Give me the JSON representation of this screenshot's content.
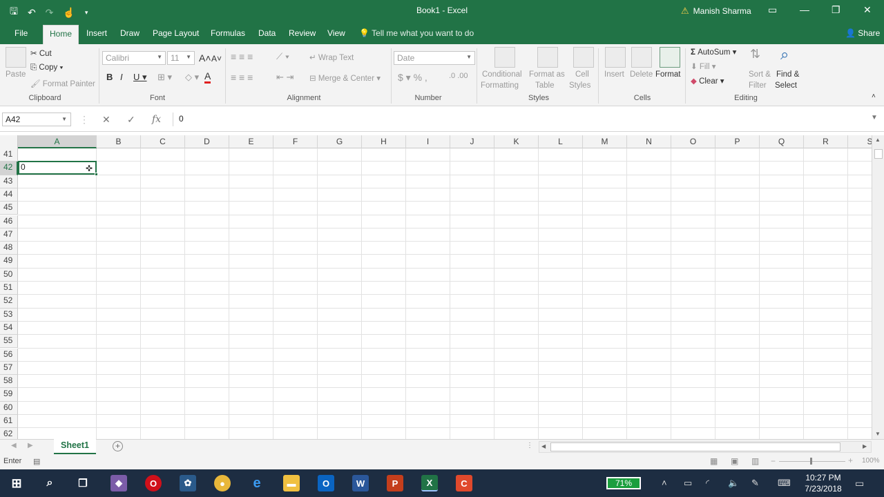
{
  "window": {
    "title": "Book1  -  Excel",
    "user": "Manish Sharma"
  },
  "tabs": [
    {
      "label": "File"
    },
    {
      "label": "Home"
    },
    {
      "label": "Insert"
    },
    {
      "label": "Draw"
    },
    {
      "label": "Page Layout"
    },
    {
      "label": "Formulas"
    },
    {
      "label": "Data"
    },
    {
      "label": "Review"
    },
    {
      "label": "View"
    }
  ],
  "tell_me": "Tell me what you want to do",
  "share": "Share",
  "ribbon": {
    "clipboard": {
      "label": "Clipboard",
      "paste": "Paste",
      "cut": "Cut",
      "copy": "Copy",
      "format_painter": "Format Painter"
    },
    "font": {
      "label": "Font",
      "name": "Calibri",
      "size": "11"
    },
    "alignment": {
      "label": "Alignment",
      "wrap_text": "Wrap Text",
      "merge_center": "Merge & Center"
    },
    "number": {
      "label": "Number",
      "format": "Date"
    },
    "styles": {
      "label": "Styles",
      "conditional": "Conditional",
      "formatting": "Formatting",
      "format_as": "Format as",
      "table": "Table",
      "cell": "Cell",
      "cell_styles": "Styles"
    },
    "cells": {
      "label": "Cells",
      "insert": "Insert",
      "delete": "Delete",
      "format": "Format"
    },
    "editing": {
      "label": "Editing",
      "autosum": "AutoSum",
      "fill": "Fill",
      "clear": "Clear",
      "sort": "Sort &",
      "filter": "Filter",
      "find": "Find &",
      "select": "Select"
    }
  },
  "formula_bar": {
    "name_box": "A42",
    "fx": "fx",
    "value": "0"
  },
  "grid": {
    "columns": [
      "A",
      "B",
      "C",
      "D",
      "E",
      "F",
      "G",
      "H",
      "I",
      "J",
      "K",
      "L",
      "M",
      "N",
      "O",
      "P",
      "Q",
      "R",
      "S"
    ],
    "rows": [
      "41",
      "42",
      "43",
      "44",
      "45",
      "46",
      "47",
      "48",
      "49",
      "50",
      "51",
      "52",
      "53",
      "54",
      "55",
      "56",
      "57",
      "58",
      "59",
      "60",
      "61",
      "62"
    ],
    "active_cell_value": "0"
  },
  "sheet_tab": "Sheet1",
  "status": {
    "mode": "Enter",
    "zoom": "100%"
  },
  "taskbar": {
    "battery": "71%",
    "time": "10:27 PM",
    "date": "7/23/2018"
  },
  "colors": {
    "excel_green": "#217346",
    "taskbar": "#1d2d42"
  }
}
